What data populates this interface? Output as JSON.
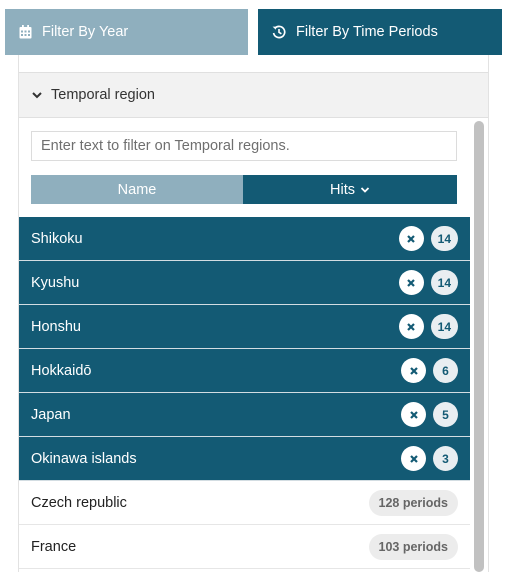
{
  "tabs": {
    "year_label": "Filter By Year",
    "year_icon": "calendar-icon",
    "periods_label": "Filter By Time Periods",
    "periods_icon": "history-icon"
  },
  "region": {
    "header": "Temporal region",
    "filter_placeholder": "Enter text to filter on Temporal regions.",
    "sort_name": "Name",
    "sort_hits": "Hits",
    "selected": [
      {
        "name": "Shikoku",
        "count": "14"
      },
      {
        "name": "Kyushu",
        "count": "14"
      },
      {
        "name": "Honshu",
        "count": "14"
      },
      {
        "name": "Hokkaidō",
        "count": "6"
      },
      {
        "name": "Japan",
        "count": "5"
      },
      {
        "name": "Okinawa islands",
        "count": "3"
      }
    ],
    "others": [
      {
        "name": "Czech republic",
        "periods": "128 periods"
      },
      {
        "name": "France",
        "periods": "103 periods"
      }
    ]
  },
  "colors": {
    "primary": "#135a74",
    "muted": "#8fafbe"
  }
}
